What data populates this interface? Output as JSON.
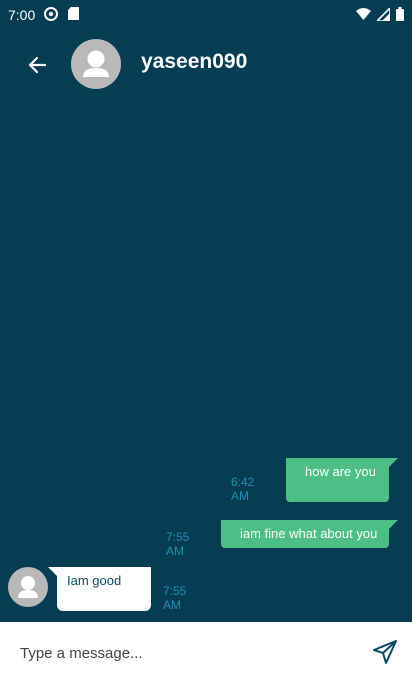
{
  "status_bar": {
    "time": "7:00",
    "left_icons": [
      "at-sign-icon",
      "sd-card-icon"
    ],
    "right_icons": [
      "wifi-icon",
      "signal-icon",
      "battery-icon"
    ]
  },
  "header": {
    "title": "yaseen090",
    "back_icon": "arrow-left-icon",
    "avatar_icon": "person-icon"
  },
  "messages": [
    {
      "direction": "outgoing",
      "text": "how are you",
      "time": "6:42 AM"
    },
    {
      "direction": "outgoing",
      "text": "iam fine what about you",
      "time": "7:55 AM"
    },
    {
      "direction": "incoming",
      "text": "Iam good",
      "time": "7:55 AM"
    }
  ],
  "composer": {
    "placeholder": "Type a message...",
    "value": "",
    "send_icon": "send-icon"
  },
  "colors": {
    "background": "#063d52",
    "outgoing_bubble": "#4dbf86",
    "incoming_bubble": "#ffffff",
    "timestamp": "#1f8fb0"
  }
}
